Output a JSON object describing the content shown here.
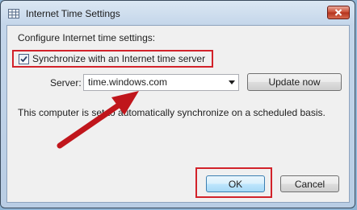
{
  "window": {
    "title": "Internet Time Settings",
    "close_icon": "close-icon"
  },
  "content": {
    "heading": "Configure Internet time settings:",
    "sync_checkbox": {
      "label": "Synchronize with an Internet time server",
      "checked": true
    },
    "server": {
      "label": "Server:",
      "value": "time.windows.com"
    },
    "update_button": "Update now",
    "status_text": "This computer is set to automatically synchronize on a scheduled basis."
  },
  "buttons": {
    "ok": "OK",
    "cancel": "Cancel"
  },
  "colors": {
    "highlight": "#d2222a",
    "arrow": "#c0161c"
  }
}
